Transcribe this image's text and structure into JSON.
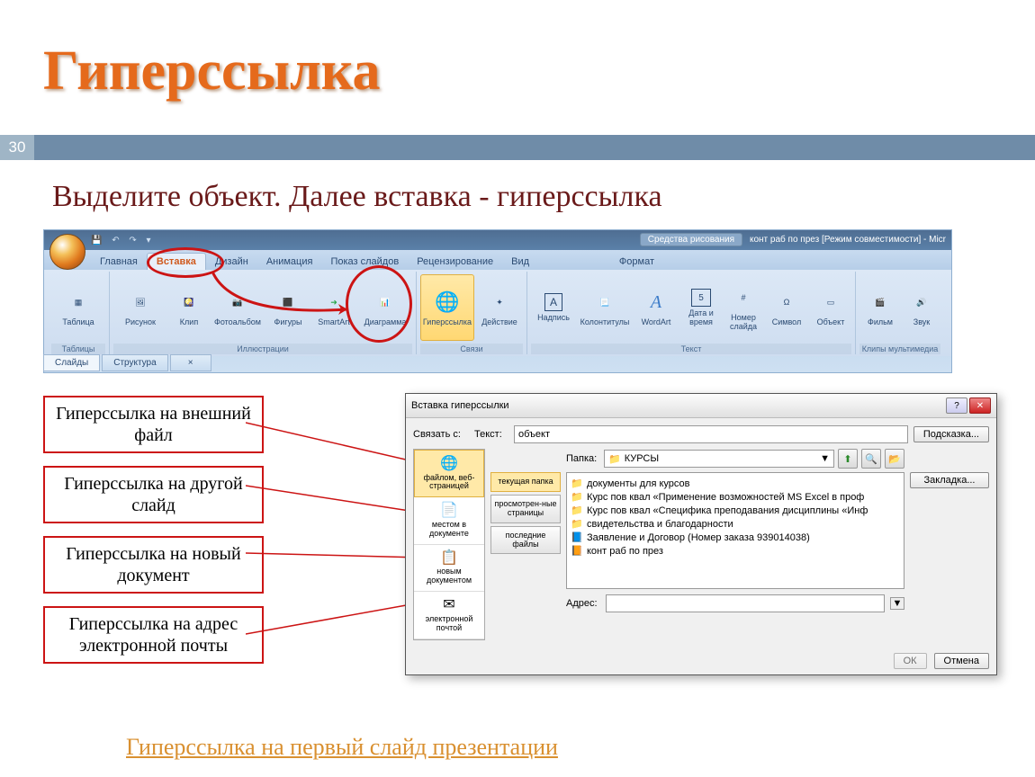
{
  "slide": {
    "title": "Гиперссылка",
    "number": "30",
    "subtitle": "Выделите объект. Далее вставка - гиперссылка",
    "bottom_link": "Гиперссылка на первый слайд презентации"
  },
  "ribbon": {
    "tools_context": "Средства рисования",
    "doc_title": "конт раб по през [Режим совместимости] - Micr",
    "tabs": [
      "Главная",
      "Вставка",
      "Дизайн",
      "Анимация",
      "Показ слайдов",
      "Рецензирование",
      "Вид",
      "Формат"
    ],
    "active_tab": "Вставка",
    "groups": {
      "tables": {
        "label": "Таблицы",
        "items": [
          "Таблица"
        ]
      },
      "illustrations": {
        "label": "Иллюстрации",
        "items": [
          "Рисунок",
          "Клип",
          "Фотоальбом",
          "Фигуры",
          "SmartArt",
          "Диаграмма"
        ]
      },
      "links": {
        "label": "Связи",
        "items": [
          "Гиперссылка",
          "Действие"
        ]
      },
      "text": {
        "label": "Текст",
        "items": [
          "Надпись",
          "Колонтитулы",
          "WordArt",
          "Дата и время",
          "Номер слайда",
          "Символ",
          "Объект"
        ]
      },
      "media": {
        "label": "Клипы мультимедиа",
        "items": [
          "Фильм",
          "Звук"
        ]
      }
    },
    "panes": {
      "slides": "Слайды",
      "structure": "Структура"
    }
  },
  "callouts": [
    "Гиперссылка на внешний файл",
    "Гиперссылка на другой слайд",
    "Гиперссылка на новый документ",
    "Гиперссылка на адрес электронной почты"
  ],
  "dialog": {
    "title": "Вставка гиперссылки",
    "link_to_label": "Связать с:",
    "text_label": "Текст:",
    "text_value": "объект",
    "hint_btn": "Подсказка...",
    "folder_label": "Папка:",
    "folder_value": "КУРСЫ",
    "bookmark_btn": "Закладка...",
    "address_label": "Адрес:",
    "ok": "ОК",
    "cancel": "Отмена",
    "linkto_items": [
      {
        "label": "файлом, веб-страницей",
        "icon": "🌐"
      },
      {
        "label": "местом в документе",
        "icon": "📄"
      },
      {
        "label": "новым документом",
        "icon": "📋"
      },
      {
        "label": "электронной почтой",
        "icon": "✉"
      }
    ],
    "browse_items": [
      "текущая папка",
      "просмотрен-ные страницы",
      "последние файлы"
    ],
    "files": [
      {
        "icon": "📁",
        "name": "документы для курсов"
      },
      {
        "icon": "📁",
        "name": "Курс пов квал «Применение возможностей MS Excel в проф"
      },
      {
        "icon": "📁",
        "name": "Курс пов квал «Специфика преподавания дисциплины «Инф"
      },
      {
        "icon": "📁",
        "name": "свидетельства и благодарности"
      },
      {
        "icon": "📘",
        "name": "Заявление и Договор (Номер заказа 939014038)"
      },
      {
        "icon": "📙",
        "name": "конт раб по през"
      }
    ]
  }
}
